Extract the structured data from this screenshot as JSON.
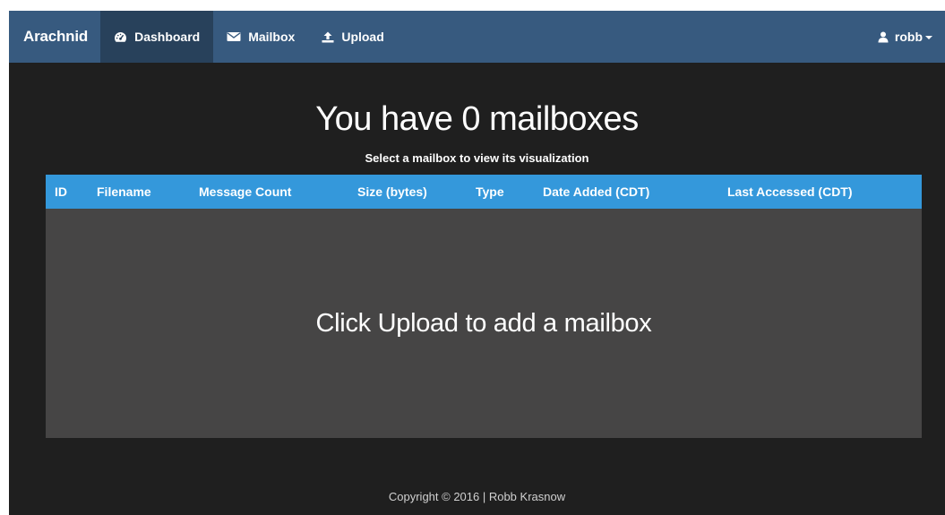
{
  "navbar": {
    "brand": "Arachnid",
    "items": [
      {
        "label": "Dashboard",
        "icon": "dashboard-icon",
        "active": true
      },
      {
        "label": "Mailbox",
        "icon": "envelope-icon",
        "active": false
      },
      {
        "label": "Upload",
        "icon": "upload-icon",
        "active": false
      }
    ],
    "user": {
      "name": "robb",
      "icon": "user-icon"
    }
  },
  "main": {
    "title": "You have 0 mailboxes",
    "subtitle": "Select a mailbox to view its visualization",
    "table": {
      "columns": [
        "ID",
        "Filename",
        "Message Count",
        "Size (bytes)",
        "Type",
        "Date Added (CDT)",
        "Last Accessed (CDT)"
      ],
      "rows": [],
      "empty_message": "Click Upload to add a mailbox"
    }
  },
  "footer": {
    "text": "Copyright © 2016 | Robb Krasnow"
  },
  "colors": {
    "navbar": "#375a7f",
    "navbar_active": "#28415b",
    "page_background": "#1f1f1f",
    "table_header": "#3498db",
    "table_body": "#464545"
  }
}
